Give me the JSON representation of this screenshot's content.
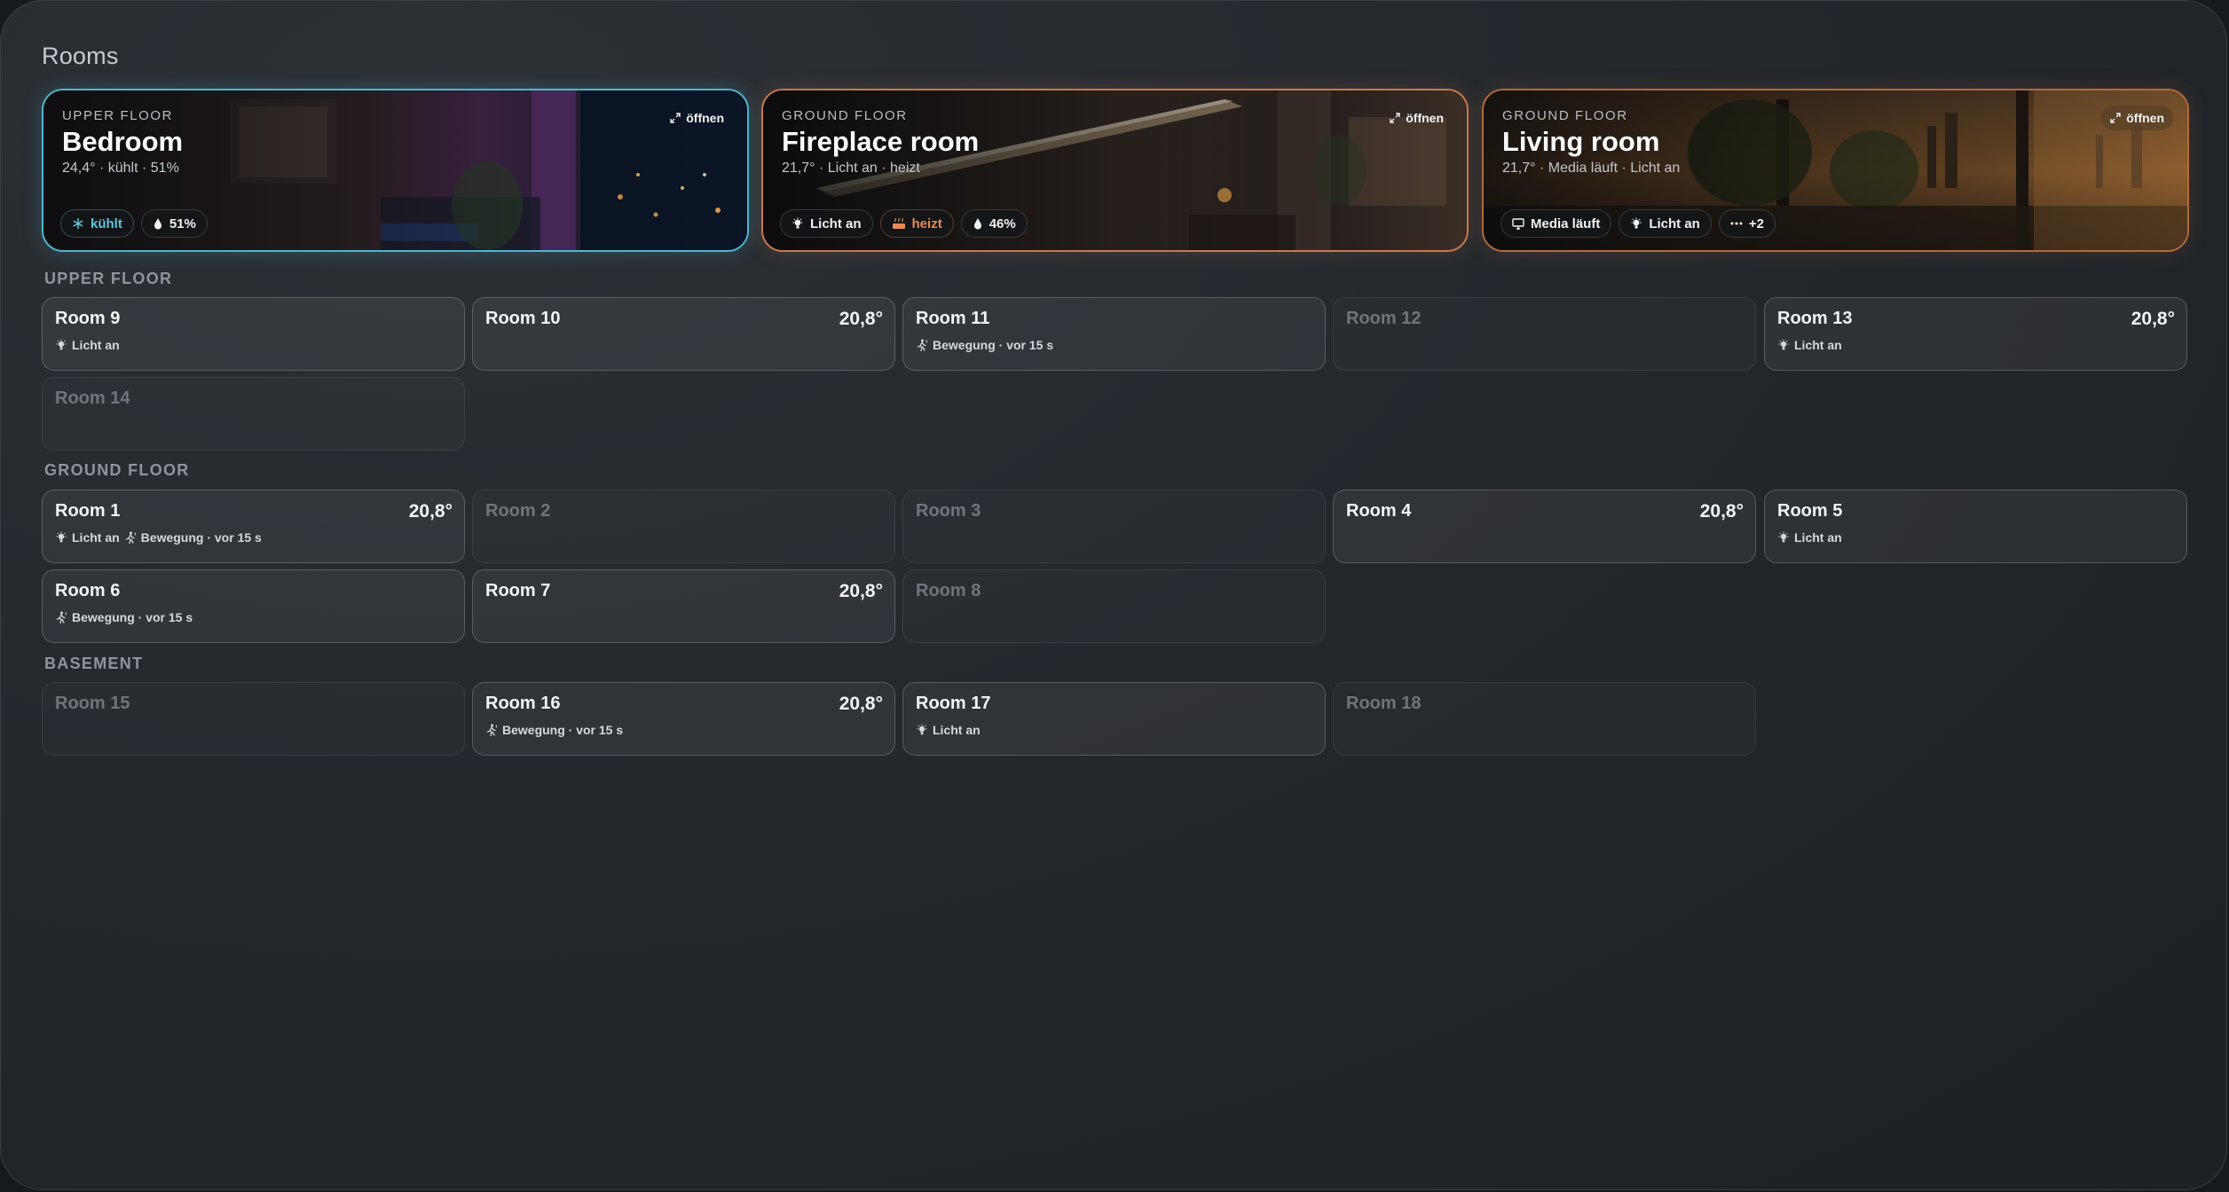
{
  "title": "Rooms",
  "heroes": [
    {
      "kicker": "UPPER FLOOR",
      "name": "Bedroom",
      "summary": "24,4° · kühlt · 51%",
      "open_label": "öffnen",
      "chips": [
        {
          "icon": "snowflake-icon",
          "label": "kühlt"
        },
        {
          "icon": "droplet-icon",
          "label": "51%"
        }
      ]
    },
    {
      "kicker": "GROUND FLOOR",
      "name": "Fireplace room",
      "summary": "21,7° · Licht an · heizt",
      "open_label": "öffnen",
      "chips": [
        {
          "icon": "lightbulb-icon",
          "label": "Licht an"
        },
        {
          "icon": "heater-icon",
          "label": "heizt"
        },
        {
          "icon": "droplet-icon",
          "label": "46%"
        }
      ]
    },
    {
      "kicker": "GROUND FLOOR",
      "name": "Living room",
      "summary": "21,7° · Media läuft · Licht an",
      "open_label": "öffnen",
      "chips": [
        {
          "icon": "monitor-icon",
          "label": "Media läuft"
        },
        {
          "icon": "lightbulb-icon",
          "label": "Licht an"
        },
        {
          "icon": "more-icon",
          "label": "+2"
        }
      ]
    }
  ],
  "sections": [
    {
      "label": "UPPER FLOOR",
      "rooms": [
        {
          "name": "Room 9",
          "temp": "",
          "status": "Licht an",
          "status_icon": "lightbulb-icon"
        },
        {
          "name": "Room 10",
          "temp": "20,8°",
          "status": "",
          "status_icon": ""
        },
        {
          "name": "Room 11",
          "temp": "",
          "status": "Bewegung · vor 15 s",
          "status_icon": "motion-icon"
        },
        {
          "name": "Room 12",
          "temp": "",
          "status": "",
          "status_icon": ""
        },
        {
          "name": "Room 13",
          "temp": "20,8°",
          "status": "Licht an",
          "status_icon": "lightbulb-icon"
        },
        {
          "name": "Room 14",
          "temp": "",
          "status": "",
          "status_icon": ""
        }
      ]
    },
    {
      "label": "GROUND FLOOR",
      "rooms": [
        {
          "name": "Room 1",
          "temp": "20,8°",
          "status": "Licht an",
          "status_icon": "lightbulb-icon",
          "status2": "Bewegung · vor 15 s",
          "status2_icon": "motion-icon"
        },
        {
          "name": "Room 2",
          "temp": "",
          "status": "",
          "status_icon": ""
        },
        {
          "name": "Room 3",
          "temp": "",
          "status": "",
          "status_icon": ""
        },
        {
          "name": "Room 4",
          "temp": "20,8°",
          "status": "",
          "status_icon": ""
        },
        {
          "name": "Room 5",
          "temp": "",
          "status": "Licht an",
          "status_icon": "lightbulb-icon"
        },
        {
          "name": "Room 6",
          "temp": "",
          "status": "Bewegung · vor 15 s",
          "status_icon": "motion-icon"
        },
        {
          "name": "Room 7",
          "temp": "20,8°",
          "status": "",
          "status_icon": ""
        },
        {
          "name": "Room 8",
          "temp": "",
          "status": "",
          "status_icon": ""
        }
      ]
    },
    {
      "label": "BASEMENT",
      "rooms": [
        {
          "name": "Room 15",
          "temp": "",
          "status": "",
          "status_icon": ""
        },
        {
          "name": "Room 16",
          "temp": "20,8°",
          "status": "Bewegung · vor 15 s",
          "status_icon": "motion-icon"
        },
        {
          "name": "Room 17",
          "temp": "",
          "status": "Licht an",
          "status_icon": "lightbulb-icon"
        },
        {
          "name": "Room 18",
          "temp": "",
          "status": "",
          "status_icon": ""
        }
      ]
    }
  ],
  "colors": {
    "cool_accent": "#4fb6cf",
    "heat_accent": "#e98a55",
    "background": "#24282d"
  }
}
